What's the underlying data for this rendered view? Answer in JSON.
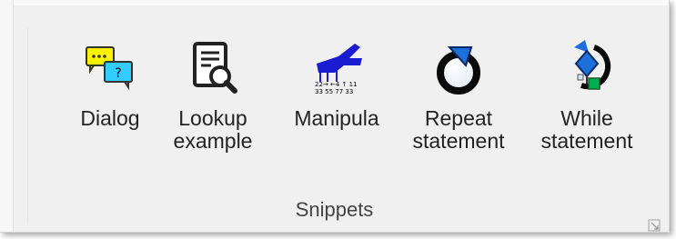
{
  "ribbon": {
    "buttons": [
      {
        "label_line1": "Dialog",
        "label_line2": "",
        "icon": "dialog-icon"
      },
      {
        "label_line1": "Lookup",
        "label_line2": "example",
        "icon": "lookup-icon"
      },
      {
        "label_line1": "Manipula",
        "label_line2": "",
        "icon": "manipula-icon"
      },
      {
        "label_line1": "Repeat",
        "label_line2": "statement",
        "icon": "repeat-icon"
      },
      {
        "label_line1": "While",
        "label_line2": "statement",
        "icon": "while-icon"
      }
    ],
    "group_label": "Snippets",
    "launcher_icon": "dialog-launcher-icon"
  },
  "colors": {
    "background": "#f0f0f0",
    "dialog_bubble_yellow": "#fff200",
    "dialog_bubble_cyan": "#33ccff",
    "manipula_blue": "#1b1bd1",
    "repeat_blue": "#1a5fb4",
    "while_green": "#00b050"
  }
}
